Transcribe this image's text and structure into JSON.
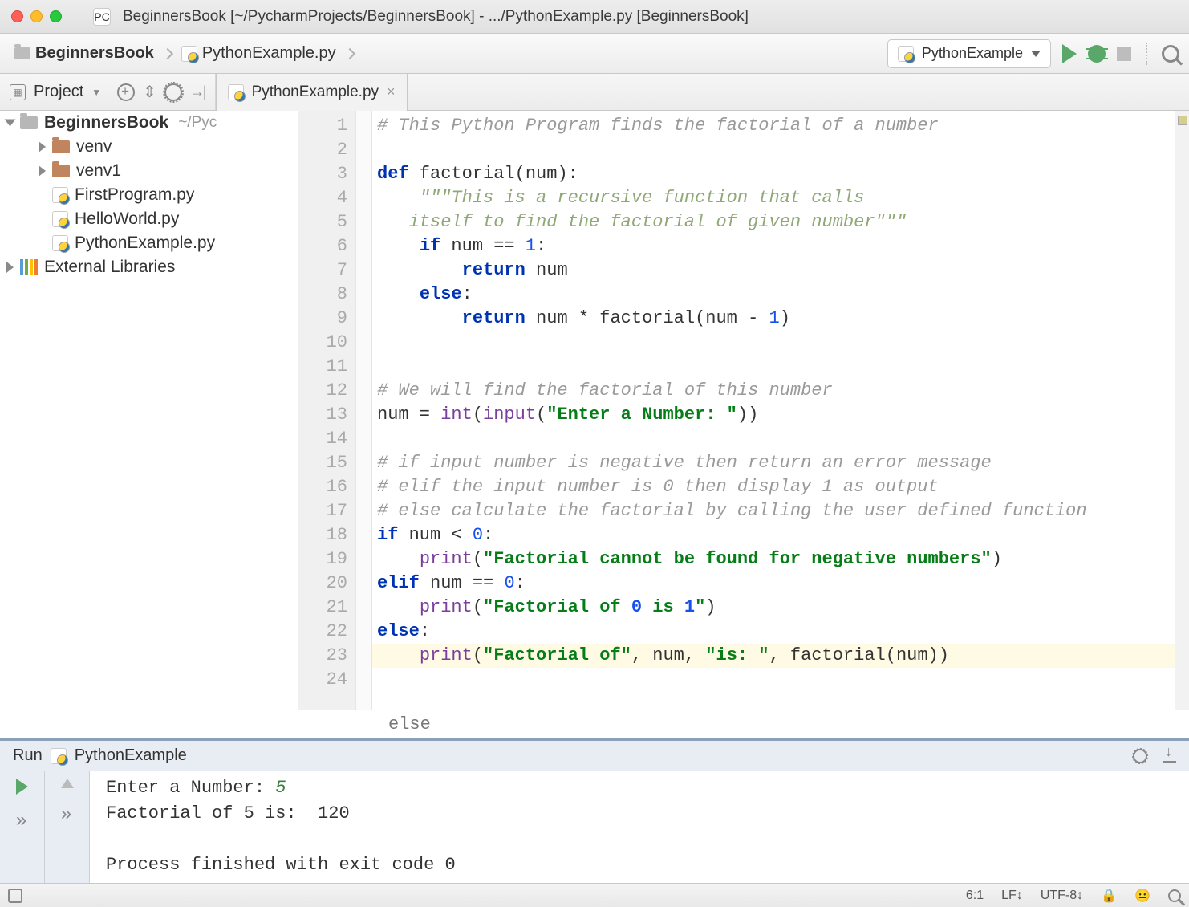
{
  "titlebar": {
    "title": "BeginnersBook [~/PycharmProjects/BeginnersBook] - .../PythonExample.py [BeginnersBook]"
  },
  "breadcrumb": {
    "items": [
      {
        "label": "BeginnersBook",
        "icon": "folder"
      },
      {
        "label": "PythonExample.py",
        "icon": "pyfile"
      }
    ]
  },
  "run_config": {
    "selected": "PythonExample"
  },
  "toolstrip": {
    "project_label": "Project"
  },
  "editor_tab": {
    "filename": "PythonExample.py"
  },
  "project_tree": {
    "nodes": [
      {
        "label": "BeginnersBook",
        "suffix": "~/Pyc",
        "indent": 0,
        "icon": "folder-gray",
        "arrow": "open",
        "bold": true
      },
      {
        "label": "venv",
        "indent": 1,
        "icon": "folder",
        "arrow": "closed"
      },
      {
        "label": "venv1",
        "indent": 1,
        "icon": "folder",
        "arrow": "closed"
      },
      {
        "label": "FirstProgram.py",
        "indent": 1,
        "icon": "pyfile",
        "arrow": "none"
      },
      {
        "label": "HelloWorld.py",
        "indent": 1,
        "icon": "pyfile",
        "arrow": "none"
      },
      {
        "label": "PythonExample.py",
        "indent": 1,
        "icon": "pyfile",
        "arrow": "none"
      },
      {
        "label": "External Libraries",
        "indent": 0,
        "icon": "extlib",
        "arrow": "closed"
      }
    ]
  },
  "code": {
    "line_count": 24,
    "highlighted_line": 23,
    "crumb": "else",
    "lines": [
      "# This Python Program finds the factorial of a number",
      "",
      "def factorial(num):",
      "    \"\"\"This is a recursive function that calls",
      "   itself to find the factorial of given number\"\"\"",
      "    if num == 1:",
      "        return num",
      "    else:",
      "        return num * factorial(num - 1)",
      "",
      "",
      "# We will find the factorial of this number",
      "num = int(input(\"Enter a Number: \"))",
      "",
      "# if input number is negative then return an error message",
      "# elif the input number is 0 then display 1 as output",
      "# else calculate the factorial by calling the user defined function",
      "if num < 0:",
      "    print(\"Factorial cannot be found for negative numbers\")",
      "elif num == 0:",
      "    print(\"Factorial of 0 is 1\")",
      "else:",
      "    print(\"Factorial of\", num, \"is: \", factorial(num))",
      ""
    ]
  },
  "run_panel": {
    "title_prefix": "Run",
    "title": "PythonExample",
    "console": {
      "prompt": "Enter a Number: ",
      "input": "5",
      "result": "Factorial of 5 is:  120",
      "exit": "Process finished with exit code 0"
    }
  },
  "statusbar": {
    "cursor": "6:1",
    "line_sep": "LF",
    "encoding": "UTF-8"
  }
}
